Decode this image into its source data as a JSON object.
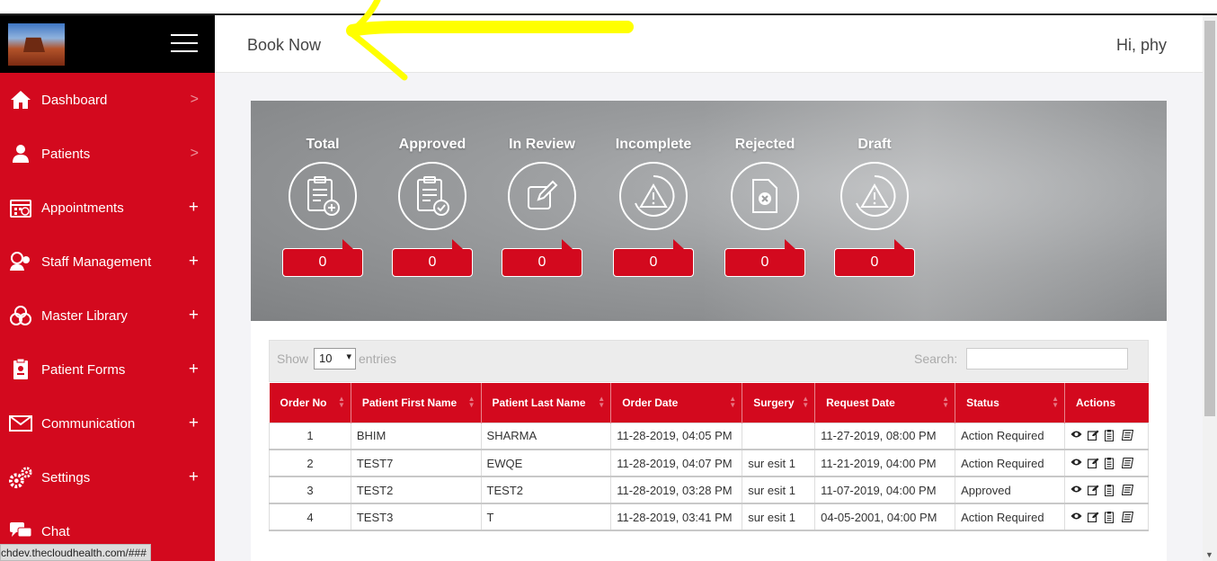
{
  "header": {
    "book_now": "Book Now",
    "greeting": "Hi, phy"
  },
  "sidebar": {
    "items": [
      {
        "label": "Dashboard",
        "icon": "home-icon",
        "indicator": ">"
      },
      {
        "label": "Patients",
        "icon": "person-icon",
        "indicator": ">"
      },
      {
        "label": "Appointments",
        "icon": "calendar-icon",
        "indicator": "+"
      },
      {
        "label": "Staff Management",
        "icon": "staff-icon",
        "indicator": "+"
      },
      {
        "label": "Master Library",
        "icon": "library-icon",
        "indicator": "+"
      },
      {
        "label": "Patient Forms",
        "icon": "form-icon",
        "indicator": "+"
      },
      {
        "label": "Communication",
        "icon": "envelope-icon",
        "indicator": "+"
      },
      {
        "label": "Settings",
        "icon": "gears-icon",
        "indicator": "+"
      },
      {
        "label": "Chat",
        "icon": "chat-icon",
        "indicator": ""
      }
    ]
  },
  "stats": [
    {
      "title": "Total",
      "count": "0",
      "icon": "clipboard-plus-icon"
    },
    {
      "title": "Approved",
      "count": "0",
      "icon": "clipboard-check-icon"
    },
    {
      "title": "In Review",
      "count": "0",
      "icon": "edit-icon"
    },
    {
      "title": "Incomplete",
      "count": "0",
      "icon": "warning-icon"
    },
    {
      "title": "Rejected",
      "count": "0",
      "icon": "rejected-file-icon"
    },
    {
      "title": "Draft",
      "count": "0",
      "icon": "draft-warning-icon"
    }
  ],
  "table_controls": {
    "show_label": "Show",
    "page_length": "10",
    "entries_label": "entries",
    "search_label": "Search:",
    "search_value": ""
  },
  "table": {
    "columns": [
      "Order No",
      "Patient First Name",
      "Patient Last Name",
      "Order Date",
      "Surgery",
      "Request Date",
      "Status",
      "Actions"
    ],
    "rows": [
      {
        "order_no": "1",
        "first": "BHIM",
        "last": "SHARMA",
        "order_date": "11-28-2019, 04:05 PM",
        "surgery": "",
        "request_date": "11-27-2019, 08:00 PM",
        "status": "Action Required"
      },
      {
        "order_no": "2",
        "first": "TEST7",
        "last": "EWQE",
        "order_date": "11-28-2019, 04:07 PM",
        "surgery": "sur esit 1",
        "request_date": "11-21-2019, 04:00 PM",
        "status": "Action Required"
      },
      {
        "order_no": "3",
        "first": "TEST2",
        "last": "TEST2",
        "order_date": "11-28-2019, 03:28 PM",
        "surgery": "sur esit 1",
        "request_date": "11-07-2019, 04:00 PM",
        "status": "Approved"
      },
      {
        "order_no": "4",
        "first": "TEST3",
        "last": "T",
        "order_date": "11-28-2019, 03:41 PM",
        "surgery": "sur esit 1",
        "request_date": "04-05-2001, 04:00 PM",
        "status": "Action Required"
      }
    ],
    "row_actions": [
      "view-icon",
      "edit-icon",
      "document-icon",
      "notes-icon"
    ]
  },
  "status_bar_url": "chdev.thecloudhealth.com/###",
  "colors": {
    "brand_red": "#d3091e",
    "annotation_yellow": "#ffff00"
  }
}
